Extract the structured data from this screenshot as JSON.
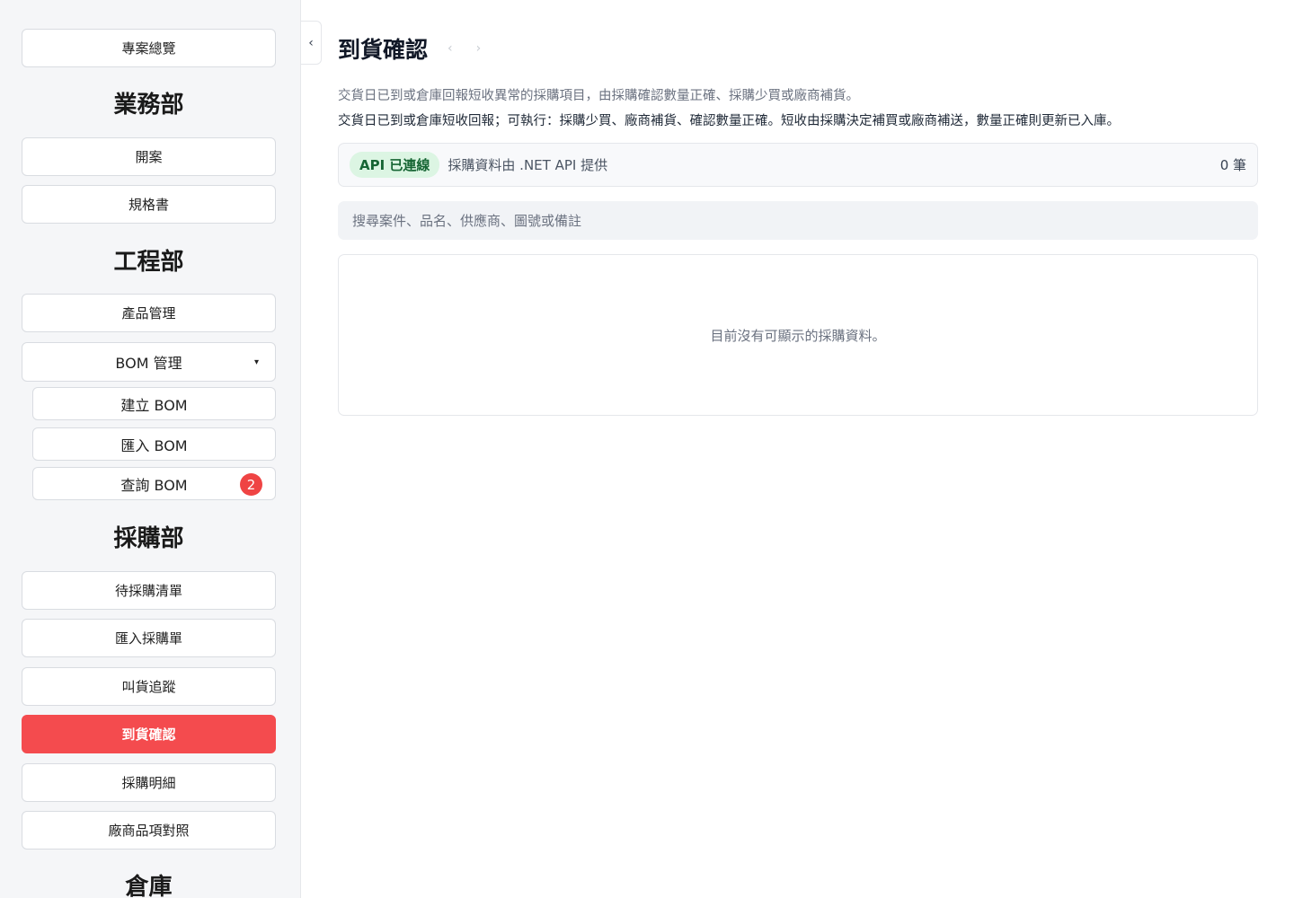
{
  "sidebar": {
    "overview": "專案總覽",
    "sections": {
      "sales": "業務部",
      "engineering": "工程部",
      "purchasing": "採購部",
      "warehouse": "倉庫"
    },
    "sales_items": [
      "開案",
      "規格書"
    ],
    "engineering_items": {
      "product_mgmt": "產品管理",
      "bom_mgmt": "BOM 管理",
      "bom_caret": "▾",
      "bom_sub": [
        "建立 BOM",
        "匯入 BOM",
        "查詢 BOM"
      ],
      "bom_query_badge": "2"
    },
    "purchasing_items": [
      "待採購清單",
      "匯入採購單",
      "叫貨追蹤",
      "到貨確認",
      "採購明細",
      "廠商品項對照"
    ],
    "active_item": "到貨確認"
  },
  "collapse_glyph": "‹",
  "main": {
    "title": "到貨確認",
    "back_arrow": "‹",
    "forward_arrow": "›",
    "description_1": "交貨日已到或倉庫回報短收異常的採購項目，由採購確認數量正確、採購少買或廠商補貨。",
    "description_2": "交貨日已到或倉庫短收回報；可執行：採購少買、廠商補貨、確認數量正確。短收由採購決定補買或廠商補送，數量正確則更新已入庫。",
    "api_status": "API 已連線",
    "api_source": "採購資料由 .NET API 提供",
    "record_count": "0 筆",
    "search_placeholder": "搜尋案件、品名、供應商、圖號或備註",
    "empty_message": "目前沒有可顯示的採購資料。"
  },
  "colors": {
    "accent": "#f44b4e",
    "badge": "#ef4444",
    "api_ok_bg": "#dcf5e3",
    "api_ok_text": "#166534"
  }
}
